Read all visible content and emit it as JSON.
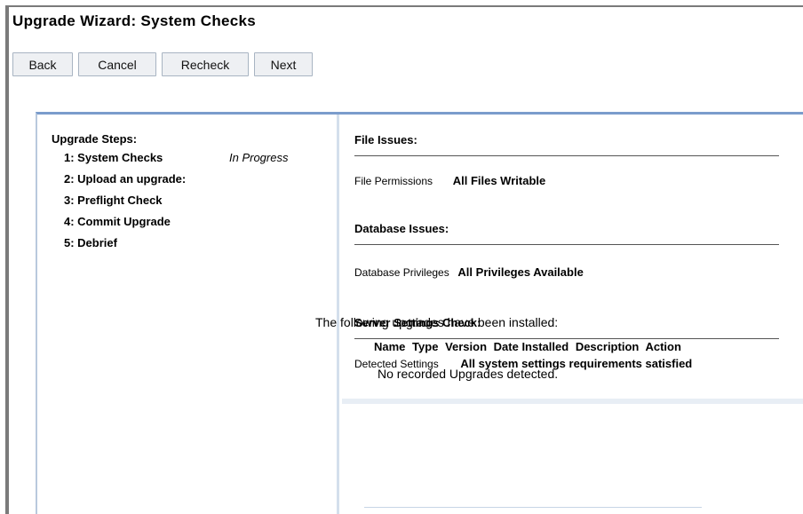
{
  "title": "Upgrade Wizard: System Checks",
  "toolbar": {
    "back": "Back",
    "cancel": "Cancel",
    "recheck": "Recheck",
    "next": "Next"
  },
  "steps": {
    "heading": "Upgrade Steps:",
    "items": [
      {
        "label": "1: System Checks",
        "status": "In Progress"
      },
      {
        "label": "2: Upload an upgrade:"
      },
      {
        "label": "3: Preflight Check"
      },
      {
        "label": "4: Commit Upgrade"
      },
      {
        "label": "5: Debrief"
      }
    ]
  },
  "checks": {
    "file": {
      "title": "File Issues:",
      "label": "File Permissions",
      "value": "All Files Writable"
    },
    "database": {
      "title": "Database Issues:",
      "label": "Database Privileges",
      "value": "All Privileges Available"
    },
    "server": {
      "title": "Server Settings Check:",
      "label": "Detected Settings",
      "value": "All system settings requirements satisfied"
    }
  },
  "installed": {
    "intro": "The following upgrades have been installed:",
    "columns": [
      "Name",
      "Type",
      "Version",
      "Date Installed",
      "Description",
      "Action"
    ],
    "empty": "No recorded Upgrades detected."
  },
  "colors": {
    "panel_border": "#7a9ccc",
    "frame": "#7a7a7a",
    "button_bg": "#eef0f3"
  }
}
